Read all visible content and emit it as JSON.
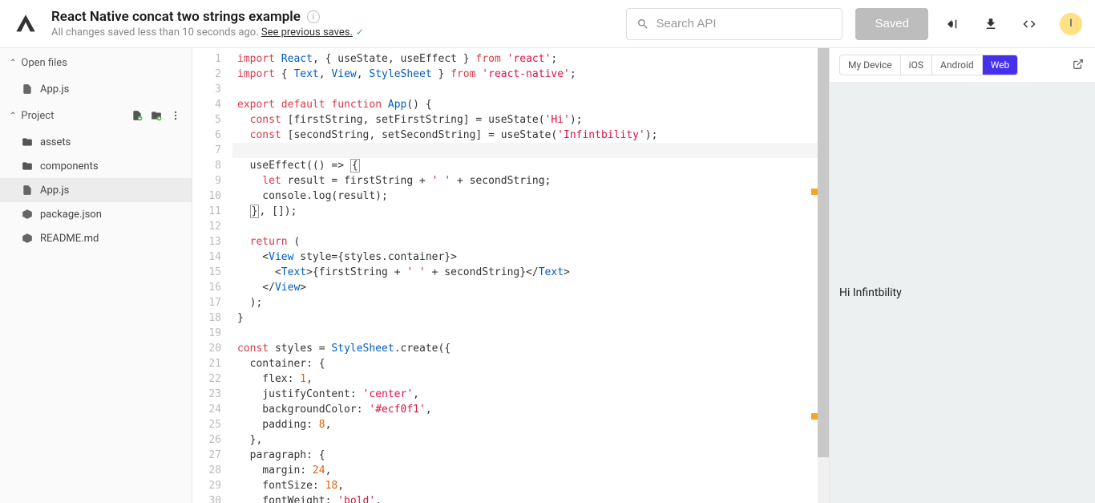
{
  "header": {
    "title": "React Native concat two strings example",
    "subtitle_prefix": "All changes saved less than 10 seconds ago. ",
    "subtitle_link": "See previous saves.",
    "search_placeholder": "Search API",
    "saved_label": "Saved",
    "avatar_initial": "I"
  },
  "sidebar": {
    "open_files_label": "Open files",
    "project_label": "Project",
    "open_files": [
      {
        "name": "App.js",
        "type": "js"
      }
    ],
    "project_files": [
      {
        "name": "assets",
        "type": "folder"
      },
      {
        "name": "components",
        "type": "folder"
      },
      {
        "name": "App.js",
        "type": "js",
        "active": true
      },
      {
        "name": "package.json",
        "type": "json"
      },
      {
        "name": "README.md",
        "type": "md"
      }
    ]
  },
  "editor": {
    "lines": [
      [
        [
          "kw",
          "import"
        ],
        [
          "def",
          " "
        ],
        [
          "cls",
          "React"
        ],
        [
          "punc",
          ", { "
        ],
        [
          "def",
          "useState"
        ],
        [
          "punc",
          ", "
        ],
        [
          "def",
          "useEffect"
        ],
        [
          "punc",
          " } "
        ],
        [
          "kw",
          "from"
        ],
        [
          "def",
          " "
        ],
        [
          "str",
          "'react'"
        ],
        [
          "punc",
          ";"
        ]
      ],
      [
        [
          "kw",
          "import"
        ],
        [
          "def",
          " { "
        ],
        [
          "cls",
          "Text"
        ],
        [
          "punc",
          ", "
        ],
        [
          "cls",
          "View"
        ],
        [
          "punc",
          ", "
        ],
        [
          "cls",
          "StyleSheet"
        ],
        [
          "def",
          " } "
        ],
        [
          "kw",
          "from"
        ],
        [
          "def",
          " "
        ],
        [
          "str",
          "'react-native'"
        ],
        [
          "punc",
          ";"
        ]
      ],
      [],
      [
        [
          "kw",
          "export"
        ],
        [
          "def",
          " "
        ],
        [
          "kw",
          "default"
        ],
        [
          "def",
          " "
        ],
        [
          "kw",
          "function"
        ],
        [
          "def",
          " "
        ],
        [
          "fn",
          "App"
        ],
        [
          "punc",
          "() {"
        ]
      ],
      [
        [
          "def",
          "  "
        ],
        [
          "kw",
          "const"
        ],
        [
          "def",
          " [firstString, setFirstString] = useState("
        ],
        [
          "str",
          "'Hi'"
        ],
        [
          "def",
          ");"
        ]
      ],
      [
        [
          "def",
          "  "
        ],
        [
          "kw",
          "const"
        ],
        [
          "def",
          " [secondString, setSecondString] = useState("
        ],
        [
          "str",
          "'Infintbility'"
        ],
        [
          "def",
          ");"
        ]
      ],
      [],
      [
        [
          "def",
          "  useEffect(() => "
        ],
        [
          "cursor",
          "{"
        ]
      ],
      [
        [
          "def",
          "    "
        ],
        [
          "kw",
          "let"
        ],
        [
          "def",
          " result = firstString + "
        ],
        [
          "str",
          "' '"
        ],
        [
          "def",
          " + secondString;"
        ]
      ],
      [
        [
          "def",
          "    console.log(result);"
        ]
      ],
      [
        [
          "def",
          "  "
        ],
        [
          "cursor",
          "}"
        ],
        [
          "def",
          ", []);"
        ]
      ],
      [],
      [
        [
          "def",
          "  "
        ],
        [
          "kw",
          "return"
        ],
        [
          "def",
          " ("
        ]
      ],
      [
        [
          "def",
          "    <"
        ],
        [
          "cls",
          "View"
        ],
        [
          "def",
          " style={styles.container}>"
        ]
      ],
      [
        [
          "def",
          "      <"
        ],
        [
          "cls",
          "Text"
        ],
        [
          "def",
          ">{firstString + "
        ],
        [
          "str",
          "' '"
        ],
        [
          "def",
          " + secondString}</"
        ],
        [
          "cls",
          "Text"
        ],
        [
          "def",
          ">"
        ]
      ],
      [
        [
          "def",
          "    </"
        ],
        [
          "cls",
          "View"
        ],
        [
          "def",
          ">"
        ]
      ],
      [
        [
          "def",
          "  );"
        ]
      ],
      [
        [
          "def",
          "}"
        ]
      ],
      [],
      [
        [
          "kw",
          "const"
        ],
        [
          "def",
          " styles = "
        ],
        [
          "cls",
          "StyleSheet"
        ],
        [
          "def",
          ".create({"
        ]
      ],
      [
        [
          "def",
          "  container: {"
        ]
      ],
      [
        [
          "def",
          "    flex: "
        ],
        [
          "num",
          "1"
        ],
        [
          "def",
          ","
        ]
      ],
      [
        [
          "def",
          "    justifyContent: "
        ],
        [
          "str",
          "'center'"
        ],
        [
          "def",
          ","
        ]
      ],
      [
        [
          "def",
          "    backgroundColor: "
        ],
        [
          "str",
          "'#ecf0f1'"
        ],
        [
          "def",
          ","
        ]
      ],
      [
        [
          "def",
          "    padding: "
        ],
        [
          "num",
          "8"
        ],
        [
          "def",
          ","
        ]
      ],
      [
        [
          "def",
          "  },"
        ]
      ],
      [
        [
          "def",
          "  paragraph: {"
        ]
      ],
      [
        [
          "def",
          "    margin: "
        ],
        [
          "num",
          "24"
        ],
        [
          "def",
          ","
        ]
      ],
      [
        [
          "def",
          "    fontSize: "
        ],
        [
          "num",
          "18"
        ],
        [
          "def",
          ","
        ]
      ],
      [
        [
          "def",
          "    fontWeight: "
        ],
        [
          "str",
          "'bold'"
        ],
        [
          "def",
          ","
        ]
      ]
    ]
  },
  "preview": {
    "tabs": [
      "My Device",
      "iOS",
      "Android",
      "Web"
    ],
    "active_tab": "Web",
    "output": "Hi Infintbility"
  }
}
